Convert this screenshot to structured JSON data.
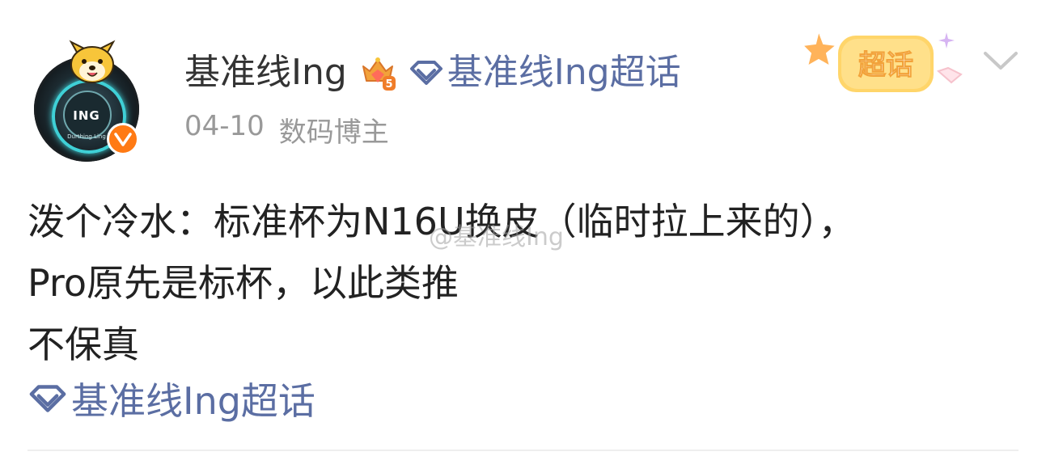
{
  "header": {
    "username": "基准线Ing",
    "crown_level": "5",
    "super_topic_link": "基准线Ing超话",
    "date": "04-10",
    "role": "数码博主",
    "sticker_text": "超话",
    "avatar_text": "ING",
    "avatar_subtext": "Durthing Ling"
  },
  "post": {
    "lines": [
      "泼个冷水：标准杯为N16U换皮（临时拉上来的），",
      "Pro原先是标杯，以此类推",
      "不保真"
    ],
    "watermark": "@基准线Ing",
    "topic_tag": "基准线Ing超话"
  },
  "colors": {
    "link": "#5b6ea3",
    "meta": "#999999",
    "verified": "#ff7a14",
    "text": "#222222"
  },
  "icons": [
    "crown-icon",
    "diamond-icon",
    "verified-v-icon",
    "chevron-down-icon",
    "chaohua-sticker"
  ]
}
